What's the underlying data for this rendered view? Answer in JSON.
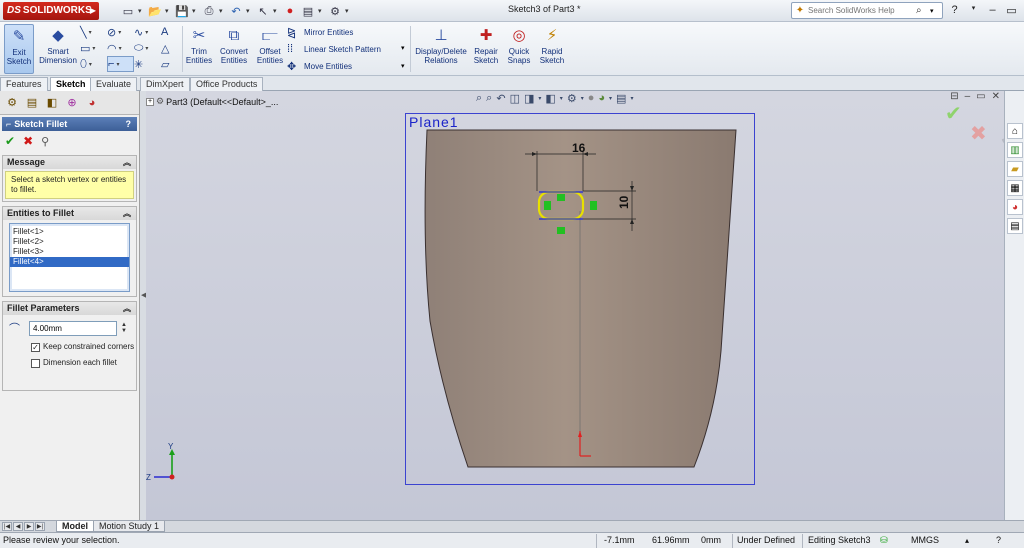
{
  "app": {
    "brand": "SOLIDWORKS",
    "document_title": "Sketch3 of Part3 *",
    "help_search_placeholder": "Search SolidWorks Help"
  },
  "command_manager": {
    "exit_sketch": "Exit Sketch",
    "smart_dimension": "Smart Dimension",
    "trim_entities": "Trim Entities",
    "convert_entities": "Convert Entities",
    "offset_entities": "Offset Entities",
    "mirror_entities": "Mirror Entities",
    "linear_sketch_pattern": "Linear Sketch Pattern",
    "move_entities": "Move Entities",
    "display_delete_relations": "Display/Delete Relations",
    "repair_sketch": "Repair Sketch",
    "quick_snaps": "Quick Snaps",
    "rapid_sketch": "Rapid Sketch"
  },
  "tabs": [
    {
      "label": "Features"
    },
    {
      "label": "Sketch"
    },
    {
      "label": "Evaluate"
    },
    {
      "label": "DimXpert"
    },
    {
      "label": "Office Products"
    }
  ],
  "property_manager": {
    "title": "Sketch Fillet",
    "help": "?",
    "message_header": "Message",
    "message_text": "Select a sketch vertex or entities to fillet.",
    "entities_header": "Entities to Fillet",
    "entities": [
      "Fillet<1>",
      "Fillet<2>",
      "Fillet<3>",
      "Fillet<4>"
    ],
    "params_header": "Fillet Parameters",
    "radius_value": "4.00mm",
    "keep_constrained_corners": "Keep constrained corners",
    "dimension_each_fillet": "Dimension each fillet",
    "keep_constrained_checked": true,
    "dimension_each_checked": false
  },
  "graphics": {
    "tree_item": "Part3  (Default<<Default>_...",
    "plane_label": "Plane1",
    "dim_width": "16",
    "dim_height": "10",
    "triad_y": "Y",
    "triad_z": "Z"
  },
  "bottom_tabs": [
    {
      "label": "Model"
    },
    {
      "label": "Motion Study 1"
    }
  ],
  "status": {
    "message": "Please review your selection.",
    "x": "-7.1mm",
    "y": "61.96mm",
    "z": "0mm",
    "state": "Under Defined",
    "editing": "Editing Sketch3",
    "units": "MMGS"
  },
  "colors": {
    "accent_blue": "#316ac5",
    "plane_border": "#3b43d0",
    "part_face": "#9c8b80",
    "sketch_yellow": "#e8e000",
    "relation_green": "#22c022",
    "origin_red": "#e02020"
  }
}
